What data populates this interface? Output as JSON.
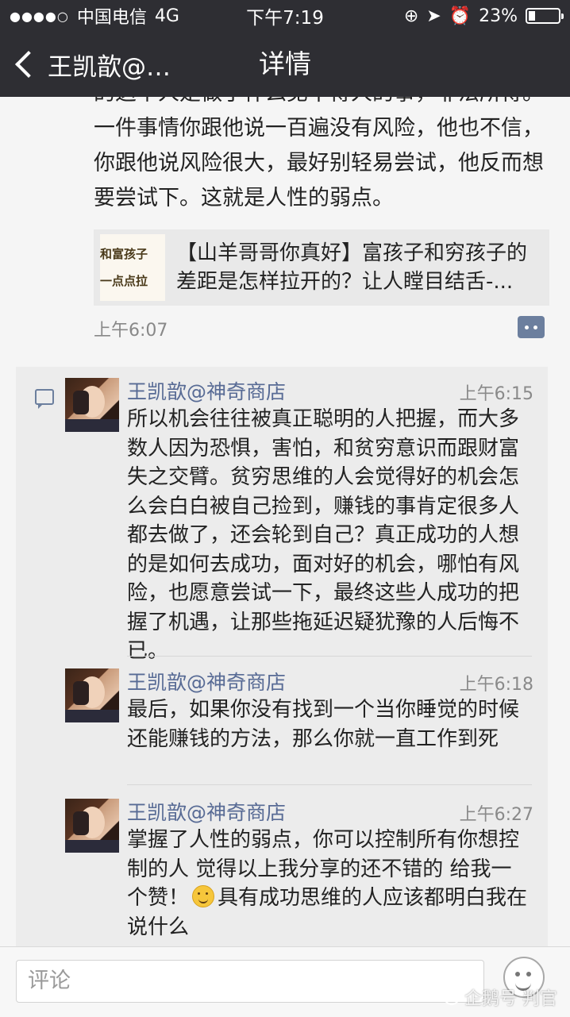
{
  "status_bar": {
    "carrier": "中国电信",
    "network": "4G",
    "time": "下午7:19",
    "battery": "23%",
    "battery_level": 0.23
  },
  "nav": {
    "back_label": "王凯歆@…",
    "title": "详情"
  },
  "post": {
    "text": "的这个人是做了什么见不得人的事，非法所得。一件事情你跟他说一百遍没有风险，他也不信，你跟他说风险很大，最好别轻易尝试，他反而想要尝试下。这就是人性的弱点。",
    "link_card": {
      "thumb_line1": "和富孩子",
      "thumb_line2": "一点点拉",
      "title": "【山羊哥哥你真好】富孩子和穷孩子的差距是怎样拉开的？让人瞠目结舌-..."
    },
    "time": "上午6:07"
  },
  "comments": [
    {
      "name": "王凯歆@神奇商店",
      "time": "上午6:15",
      "text": "所以机会往往被真正聪明的人把握，而大多数人因为恐惧，害怕，和贫穷意识而跟财富失之交臂。贫穷思维的人会觉得好的机会怎么会白白被自己捡到，赚钱的事肯定很多人都去做了，还会轮到自己？真正成功的人想的是如何去成功，面对好的机会，哪怕有风险，也愿意尝试一下，最终这些人成功的把握了机遇，让那些拖延迟疑犹豫的人后悔不已。"
    },
    {
      "name": "王凯歆@神奇商店",
      "time": "上午6:18",
      "text": "最后，如果你没有找到一个当你睡觉的时候还能赚钱的方法，那么你就一直工作到死"
    },
    {
      "name": "王凯歆@神奇商店",
      "time": "上午6:27",
      "text_before_emoji": "掌握了人性的弱点，你可以控制所有你想控制的人 觉得以上我分享的还不错的 给我一个赞！",
      "text_after_emoji": "具有成功思维的人应该都明白我在说什么"
    }
  ],
  "input": {
    "placeholder": "评论"
  },
  "watermark": "企鹅号 判官",
  "colors": {
    "bar_bg": "#2e2e33",
    "name_blue": "#586b95",
    "page_bg": "#f5f5f5"
  }
}
